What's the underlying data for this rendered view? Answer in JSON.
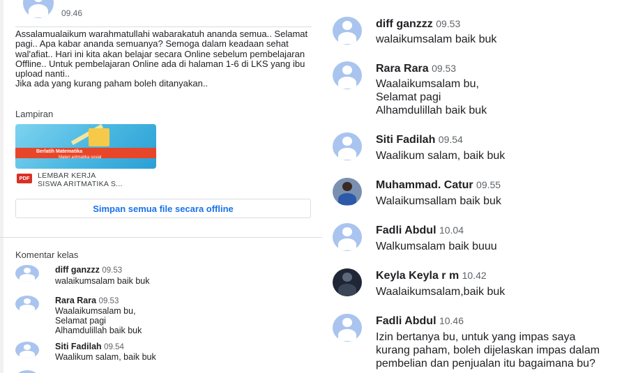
{
  "post": {
    "time": "09.46",
    "text": "Assalamualaikum warahmatullahi wabarakatuh ananda semua.. Selamat pagi.. Apa kabar ananda semuanya? Semoga dalam keadaan sehat wal'afiat.. Hari ini kita akan belajar secara Online sebelum pembelajaran Offline.. Untuk pembelajaran Online ada di halaman 1-6 di LKS yang ibu upload nanti..\nJika ada yang kurang paham boleh ditanyakan..",
    "attachments_label": "Lampiran",
    "thumbnail_title": "Berlatih Matematika",
    "thumbnail_subtitle": "Materi aritmatika sosial",
    "file_type": "PDF",
    "file_name": "LEMBAR KERJA\nSISWA ARITMATIKA S...",
    "save_button": "Simpan semua file secara offline"
  },
  "class_comments": {
    "label": "Komentar kelas",
    "items": [
      {
        "name": "diff ganzzz",
        "time": "09.53",
        "text": "walaikumsalam baik buk"
      },
      {
        "name": "Rara Rara",
        "time": "09.53",
        "text": "Waalaikumsalam bu,\nSelamat pagi\nAlhamdulillah baik buk"
      },
      {
        "name": "Siti Fadilah",
        "time": "09.54",
        "text": "Waalikum salam, baik buk"
      }
    ]
  },
  "comments_zoom": {
    "items": [
      {
        "name": "diff ganzzz",
        "time": "09.53",
        "text": "walaikumsalam baik buk",
        "avatar": "default"
      },
      {
        "name": "Rara Rara",
        "time": "09.53",
        "text": "Waalaikumsalam bu,\nSelamat pagi\nAlhamdulillah baik buk",
        "avatar": "default"
      },
      {
        "name": "Siti Fadilah",
        "time": "09.54",
        "text": "Waalikum salam, baik buk",
        "avatar": "default"
      },
      {
        "name": "Muhammad. Catur",
        "time": "09.55",
        "text": "Walaikumsallam baik buk",
        "avatar": "photo"
      },
      {
        "name": "Fadli Abdul",
        "time": "10.04",
        "text": "Walkumsalam baik buuu",
        "avatar": "default"
      },
      {
        "name": "Keyla Keyla r m",
        "time": "10.42",
        "text": "Waalaikumsalam,baik buk",
        "avatar": "dark"
      },
      {
        "name": "Fadli Abdul",
        "time": "10.46",
        "text": "Izin bertanya bu, untuk yang impas saya\nkurang paham, boleh dijelaskan impas dalam\npembelian dan penjualan itu bagaimana bu?",
        "avatar": "default"
      }
    ]
  },
  "colors": {
    "accent": "#1a73e8",
    "avatar_default": "#a9c4ee",
    "pdf_red": "#d93025"
  }
}
